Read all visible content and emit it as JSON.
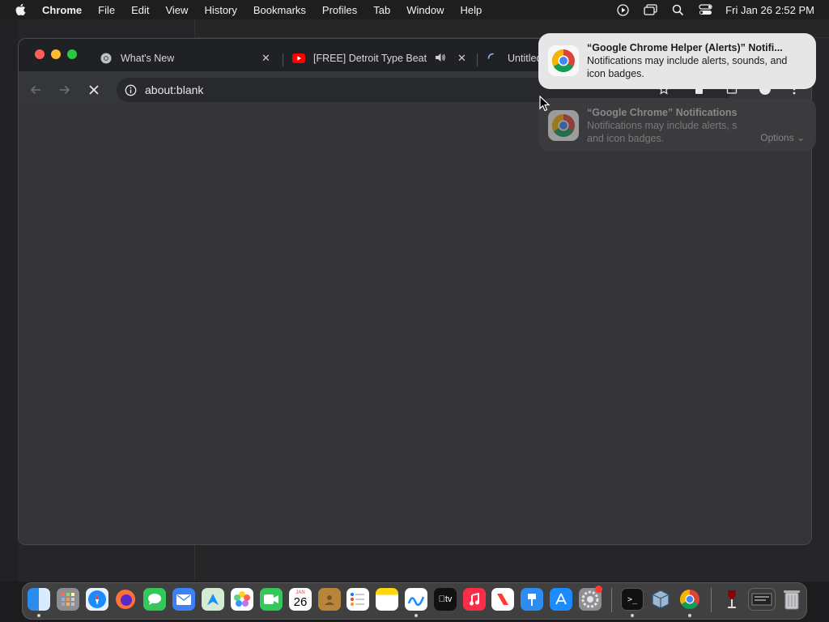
{
  "menubar": {
    "app_name": "Chrome",
    "items": [
      "File",
      "Edit",
      "View",
      "History",
      "Bookmarks",
      "Profiles",
      "Tab",
      "Window",
      "Help"
    ],
    "clock": "Fri Jan 26  2:52 PM"
  },
  "tabs": [
    {
      "title": "What's New",
      "icon": "chrome-logo-icon"
    },
    {
      "title": "[FREE] Detroit Type Beat",
      "icon": "youtube-icon",
      "audio": "speaker-icon"
    },
    {
      "title": "Untitled",
      "icon": "loading-spinner-icon"
    }
  ],
  "toolbar": {
    "url": "about:blank"
  },
  "notifications": [
    {
      "title": "“Google Chrome Helper (Alerts)” Notifi...",
      "body": "Notifications may include alerts, sounds, and icon badges."
    },
    {
      "title": "“Google Chrome” Notifications",
      "body": "Notifications may include alerts, s and icon badges.",
      "options_label": "Options"
    }
  ],
  "dock": {
    "calendar_month": "JAN",
    "calendar_day": "26",
    "tv_label": "tv"
  },
  "colors": {
    "accent_red": "#ff5f57",
    "accent_yellow": "#febc2e",
    "accent_green": "#28c840",
    "youtube_red": "#ff0000",
    "window_bg": "#303134"
  }
}
